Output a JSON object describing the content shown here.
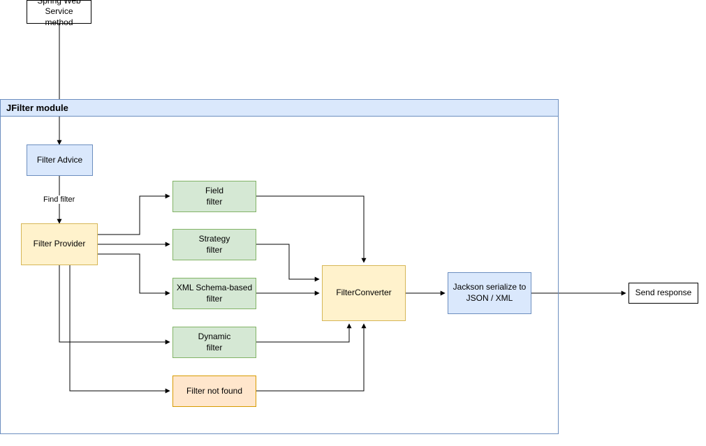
{
  "module": {
    "title": "JFilter module"
  },
  "nodes": {
    "springWS": "Spring Web Service method",
    "filterAdvice": "Filter Advice",
    "filterProvider": "Filter Provider",
    "fieldFilter": "Field\nfilter",
    "strategyFilter": "Strategy\nfilter",
    "xmlFilter": "XML Schema-based\nfilter",
    "dynamicFilter": "Dynamic\nfilter",
    "notFound": "Filter not found",
    "converter": "FilterConverter",
    "jackson": "Jackson serialize to JSON / XML",
    "sendResponse": "Send response"
  },
  "labels": {
    "findFilter": "Find filter"
  }
}
